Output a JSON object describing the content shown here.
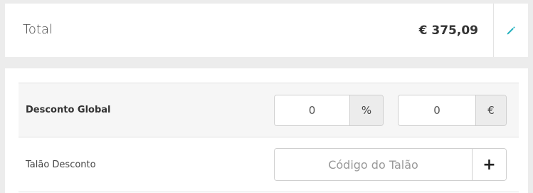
{
  "total": {
    "label": "Total",
    "value": "€ 375,09",
    "edit_icon": "pencil-icon",
    "accent_color": "#2bb3c0"
  },
  "global_discount": {
    "label": "Desconto Global",
    "percent_value": "0",
    "percent_unit": "%",
    "euro_value": "0",
    "euro_unit": "€"
  },
  "voucher": {
    "label": "Talão Desconto",
    "placeholder": "Código do Talão",
    "add_icon": "plus-icon",
    "add_label": "+"
  }
}
